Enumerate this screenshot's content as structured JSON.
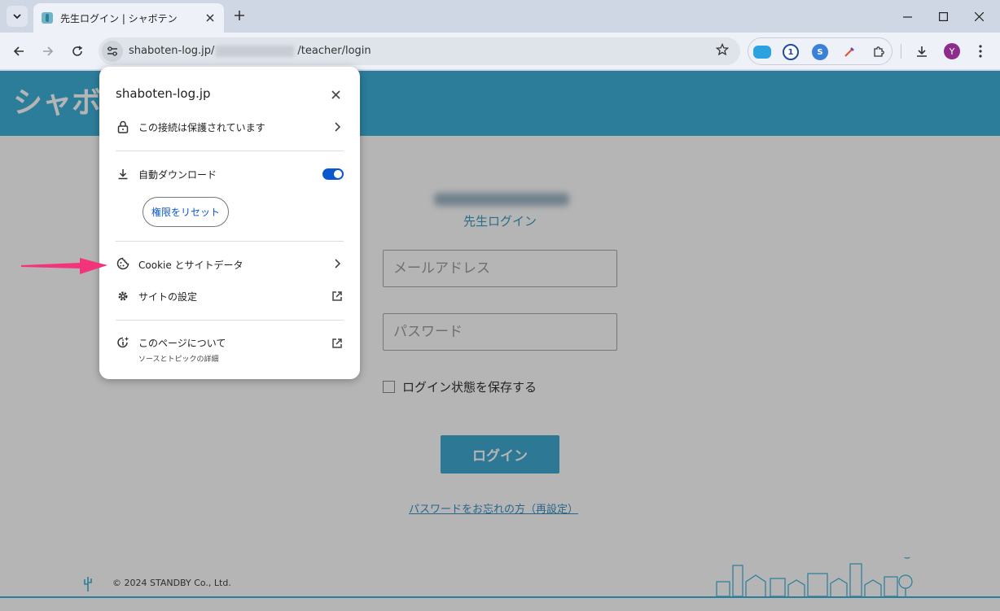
{
  "browser": {
    "tab": {
      "title": "先生ログイン | シャボテン"
    },
    "address": {
      "domain": "shaboten-log.jp/",
      "path": "/teacher/login"
    },
    "profile_initial": "Y",
    "icons": {
      "tab_search": "chevron-down-icon",
      "new_tab": "plus-icon",
      "back": "back-arrow-icon",
      "forward": "forward-arrow-icon",
      "reload": "reload-icon",
      "site_info": "tune-icon",
      "bookmark": "star-icon",
      "downloads": "download-icon",
      "menu": "kebab-icon"
    }
  },
  "page": {
    "logo_text": "シャボテ",
    "login_heading": "先生ログイン",
    "email_placeholder": "メールアドレス",
    "password_placeholder": "パスワード",
    "remember_label": "ログイン状態を保存する",
    "login_button": "ログイン",
    "forgot_link": "パスワードをお忘れの方（再設定）",
    "copyright": "© 2024 STANDBY Co., Ltd.",
    "colors": {
      "brand": "#3eb1d9",
      "button": "#3ea9d2",
      "link": "#3b8fc0"
    }
  },
  "popup": {
    "domain": "shaboten-log.jp",
    "connection_label": "この接続は保護されています",
    "auto_download_label": "自動ダウンロード",
    "auto_download_enabled": true,
    "reset_permissions_button": "権限をリセット",
    "cookies_label": "Cookie とサイトデータ",
    "site_settings_label": "サイトの設定",
    "about_page_label": "このページについて",
    "about_page_sub": "ソースとトピックの詳細",
    "colors": {
      "accent": "#0b57d0"
    }
  },
  "annotation": {
    "arrow_color": "#f2357a"
  }
}
